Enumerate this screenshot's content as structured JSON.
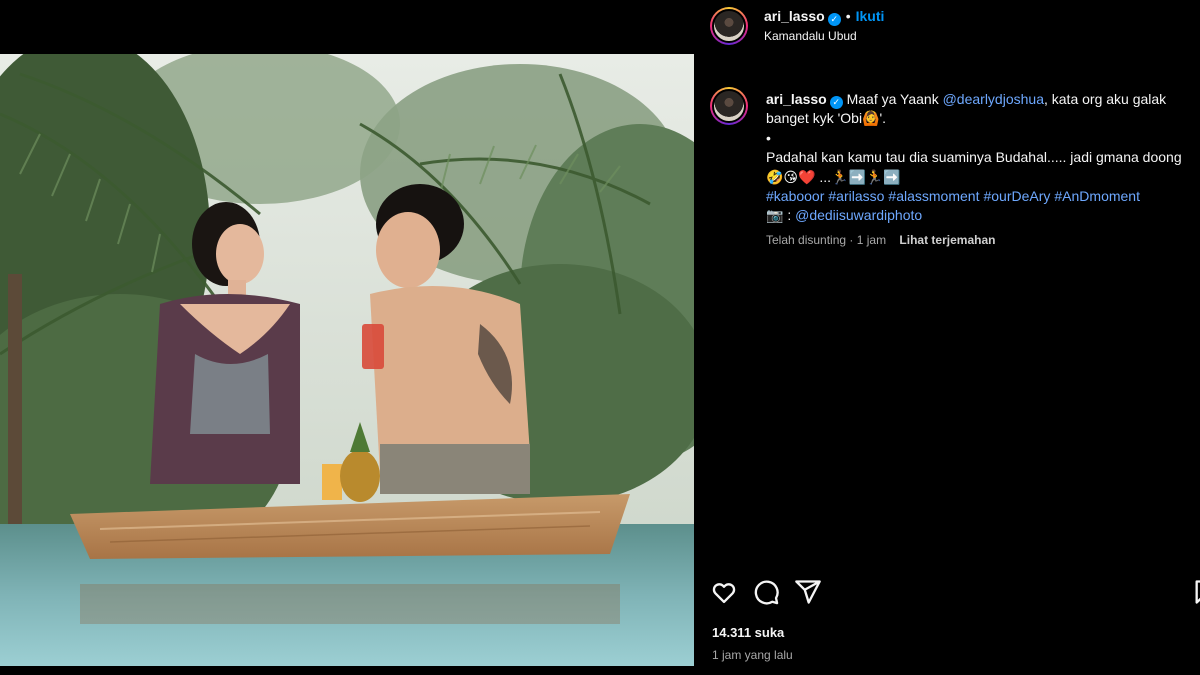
{
  "post": {
    "username": "ari_lasso",
    "follow_label": "Ikuti",
    "location": "Kamandalu Ubud",
    "more_label": "..."
  },
  "caption": {
    "username": "ari_lasso",
    "line1_text": "Maaf ya Yaank",
    "mention": "@dearlydjoshua",
    "line1_rest": ", kata org aku galak",
    "line2": "banget kyk 'Obi🙆'.",
    "line3": "•",
    "line4": "Padahal kan kamu tau dia suaminya Budahal..... jadi gmana doong",
    "line5": "🤣😘❤️ ...🏃➡️🏃➡️",
    "hashtags": [
      "#kabooor",
      "#arilasso",
      "#alassmoment",
      "#ourDeAry",
      "#AnDmoment"
    ],
    "camera_emoji": "📷",
    "credit_sep": " : ",
    "credit": "@dediisuwardiphoto",
    "edited": "Telah disunting · 1 jam",
    "translate": "Lihat terjemahan"
  },
  "stats": {
    "likes": "14.311 suka",
    "time_ago": "1 jam yang lalu"
  },
  "icons": {
    "like": "heart-icon",
    "comment": "comment-icon",
    "share": "share-icon",
    "save": "bookmark-icon",
    "accent": "#0095f6"
  }
}
